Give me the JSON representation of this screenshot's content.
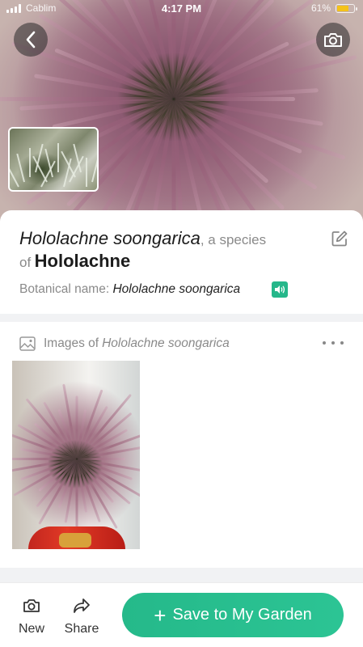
{
  "status_bar": {
    "carrier": "Cablim",
    "time": "4:17 PM",
    "battery_text": "61%",
    "battery_level": 0.7,
    "battery_color": "#f4c21a"
  },
  "hero": {
    "back_icon": "chevron-left-icon",
    "camera_icon": "camera-icon"
  },
  "species": {
    "scientific_name": "Hololachne soongarica",
    "species_suffix": ", a species",
    "of_text": "of",
    "genus": "Hololachne",
    "botanical_label": "Botanical name:",
    "botanical_value": "Hololachne soongarica",
    "edit_icon": "edit-icon",
    "sound_icon": "speaker-icon"
  },
  "images_section": {
    "heading_prefix": "Images of",
    "heading_species": "Hololachne soongarica",
    "more_icon": "more-icon"
  },
  "bottom_bar": {
    "new_label": "New",
    "share_label": "Share",
    "save_label": "Save to My Garden",
    "save_plus": "+",
    "accent_color": "#25b78a"
  }
}
